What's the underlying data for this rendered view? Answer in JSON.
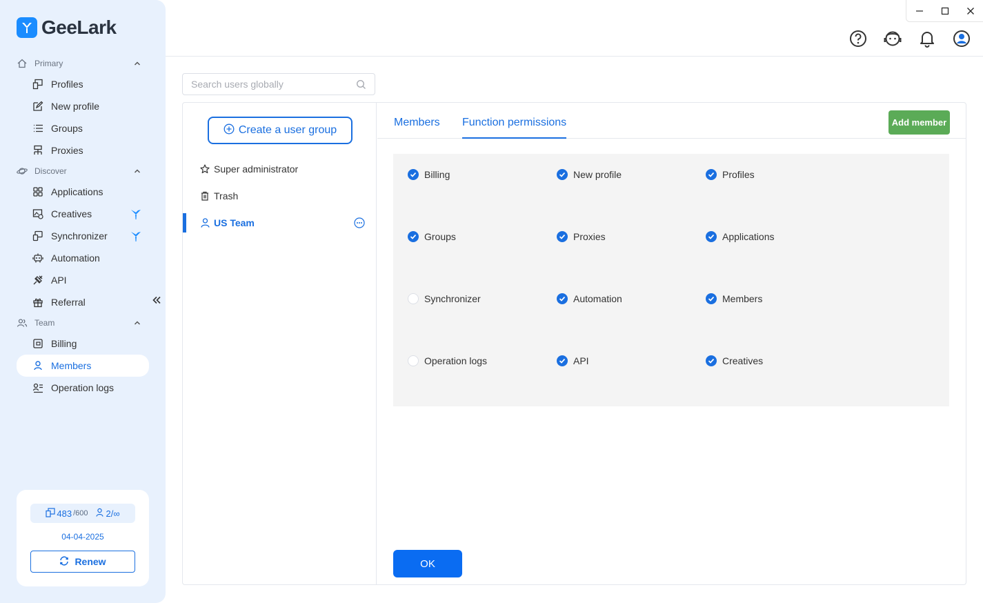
{
  "app": {
    "logo_text": "GeeLark"
  },
  "sidebar": {
    "sections": [
      {
        "label": "Primary",
        "icon": "home-icon"
      },
      {
        "label": "Discover",
        "icon": "planet-icon"
      },
      {
        "label": "Team",
        "icon": "team-icon"
      }
    ],
    "items": {
      "profiles": "Profiles",
      "new_profile": "New profile",
      "groups": "Groups",
      "proxies": "Proxies",
      "applications": "Applications",
      "creatives": "Creatives",
      "synchronizer": "Synchronizer",
      "automation": "Automation",
      "api": "API",
      "referral": "Referral",
      "billing": "Billing",
      "members": "Members",
      "operation_logs": "Operation logs"
    },
    "active_item": "Members"
  },
  "account": {
    "profiles_used": "483",
    "profiles_total": "/600",
    "members_count": "2/∞",
    "expiry_date": "04-04-2025",
    "renew_label": "Renew"
  },
  "search": {
    "placeholder": "Search users globally"
  },
  "groups_panel": {
    "create_label": "Create a user group",
    "groups": [
      {
        "label": "Super administrator",
        "icon": "star-icon"
      },
      {
        "label": "Trash",
        "icon": "trash-icon"
      },
      {
        "label": "US Team",
        "icon": "user-icon",
        "active": true
      }
    ]
  },
  "tabs": [
    {
      "label": "Members",
      "active": false
    },
    {
      "label": "Function permissions",
      "active": true
    }
  ],
  "add_member_label": "Add member",
  "permissions": [
    {
      "label": "Billing",
      "checked": true
    },
    {
      "label": "New profile",
      "checked": true
    },
    {
      "label": "Profiles",
      "checked": true
    },
    {
      "label": "Groups",
      "checked": true
    },
    {
      "label": "Proxies",
      "checked": true
    },
    {
      "label": "Applications",
      "checked": true
    },
    {
      "label": "Synchronizer",
      "checked": false
    },
    {
      "label": "Automation",
      "checked": true
    },
    {
      "label": "Members",
      "checked": true
    },
    {
      "label": "Operation logs",
      "checked": false
    },
    {
      "label": "API",
      "checked": true
    },
    {
      "label": "Creatives",
      "checked": true
    }
  ],
  "ok_label": "OK",
  "colors": {
    "accent": "#1a6fe0",
    "sidebar_bg": "#e8f1fd",
    "add_button": "#5bab57",
    "ok_button": "#0a6cf2"
  }
}
